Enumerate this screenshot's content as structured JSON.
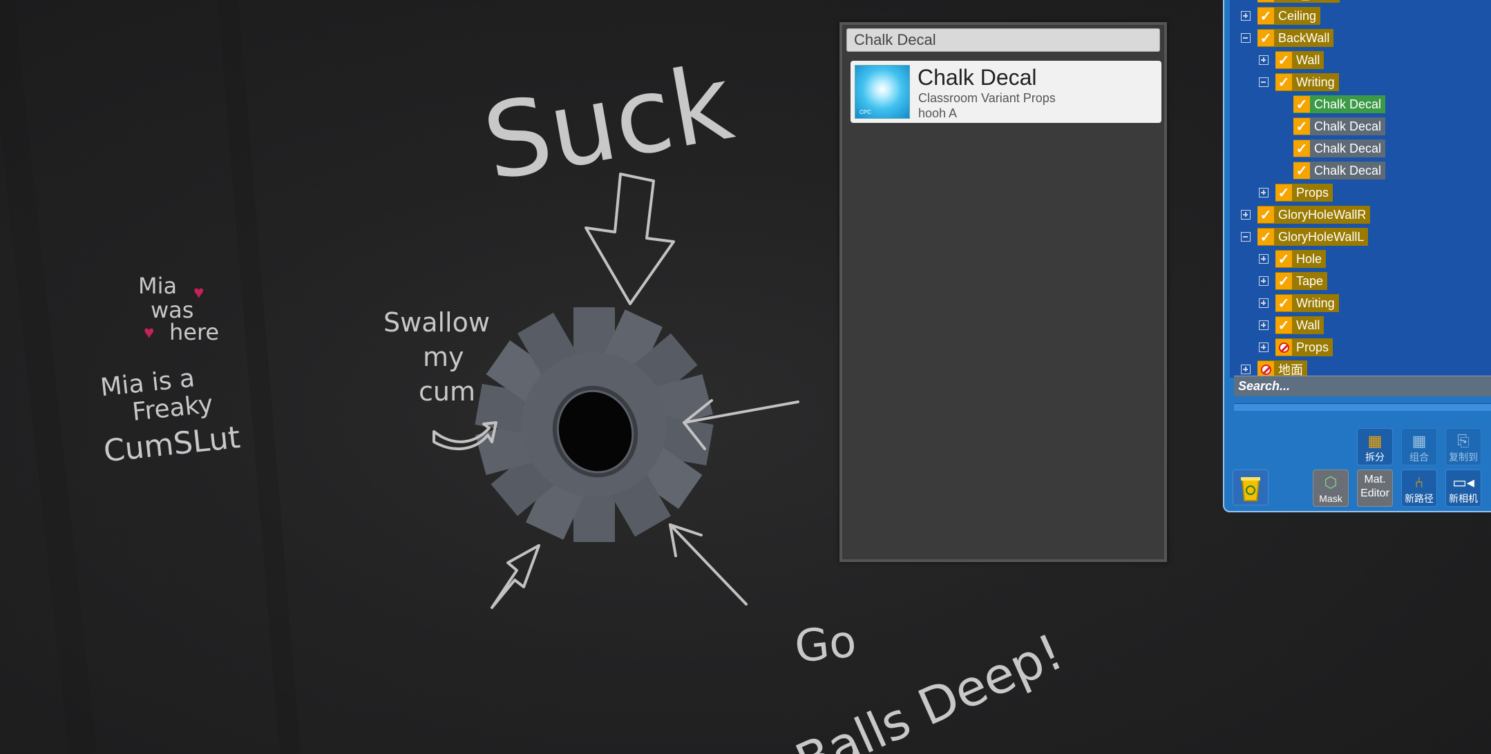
{
  "wall": {
    "suck": "Suck",
    "swallow": [
      "Swallow",
      "my",
      "cum"
    ],
    "mia_was_here": [
      "Mia",
      "was",
      "here"
    ],
    "mia_freaky": [
      "Mia is a",
      "Freaky",
      "CumSLut"
    ],
    "go": "Go",
    "balls_deep": "Balls Deep!",
    "heart_color": "#c8205a"
  },
  "info_panel": {
    "search_value": "Chalk Decal",
    "item": {
      "title": "Chalk Decal",
      "category": "Classroom Variant Props",
      "author": "hooh A",
      "thumb_tag": "CPC"
    }
  },
  "tree": {
    "items": [
      {
        "label": "Wall_Door",
        "state": "off",
        "level": 0,
        "expander": "plus"
      },
      {
        "label": "Ceiling",
        "state": "on",
        "level": 0,
        "expander": "plus"
      },
      {
        "label": "BackWall",
        "state": "on",
        "level": 0,
        "expander": "minus"
      },
      {
        "label": "Wall",
        "state": "on",
        "level": 1,
        "expander": "plus"
      },
      {
        "label": "Writing",
        "state": "on",
        "level": 1,
        "expander": "minus"
      },
      {
        "label": "Chalk Decal",
        "state": "on",
        "level": 2,
        "expander": "none",
        "selected": true
      },
      {
        "label": "Chalk Decal",
        "state": "on",
        "level": 2,
        "expander": "none",
        "dim": true
      },
      {
        "label": "Chalk Decal",
        "state": "on",
        "level": 2,
        "expander": "none",
        "dim": true
      },
      {
        "label": "Chalk Decal",
        "state": "on",
        "level": 2,
        "expander": "none",
        "dim": true
      },
      {
        "label": "Props",
        "state": "on",
        "level": 1,
        "expander": "plus"
      },
      {
        "label": "GloryHoleWallR",
        "state": "on",
        "level": 0,
        "expander": "plus"
      },
      {
        "label": "GloryHoleWallL",
        "state": "on",
        "level": 0,
        "expander": "minus"
      },
      {
        "label": "Hole",
        "state": "on",
        "level": 1,
        "expander": "plus"
      },
      {
        "label": "Tape",
        "state": "on",
        "level": 1,
        "expander": "plus"
      },
      {
        "label": "Writing",
        "state": "on",
        "level": 1,
        "expander": "plus"
      },
      {
        "label": "Wall",
        "state": "on",
        "level": 1,
        "expander": "plus"
      },
      {
        "label": "Props",
        "state": "off",
        "level": 1,
        "expander": "plus"
      },
      {
        "label": "地面",
        "state": "off",
        "level": 0,
        "expander": "plus"
      }
    ],
    "search_placeholder": "Search..."
  },
  "toolbar": {
    "split": "拆分",
    "combine": "组合",
    "copy_to": "复制到",
    "mask": "Mask",
    "mat_editor_1": "Mat.",
    "mat_editor_2": "Editor",
    "new_path": "新路径",
    "new_camera": "新相机"
  },
  "colors": {
    "panel_blue": "#2276c4",
    "tree_bg": "#1a53a7",
    "node_gold": "#9a7a00",
    "node_selected": "#3b9a45",
    "check_orange": "#f5a400"
  }
}
